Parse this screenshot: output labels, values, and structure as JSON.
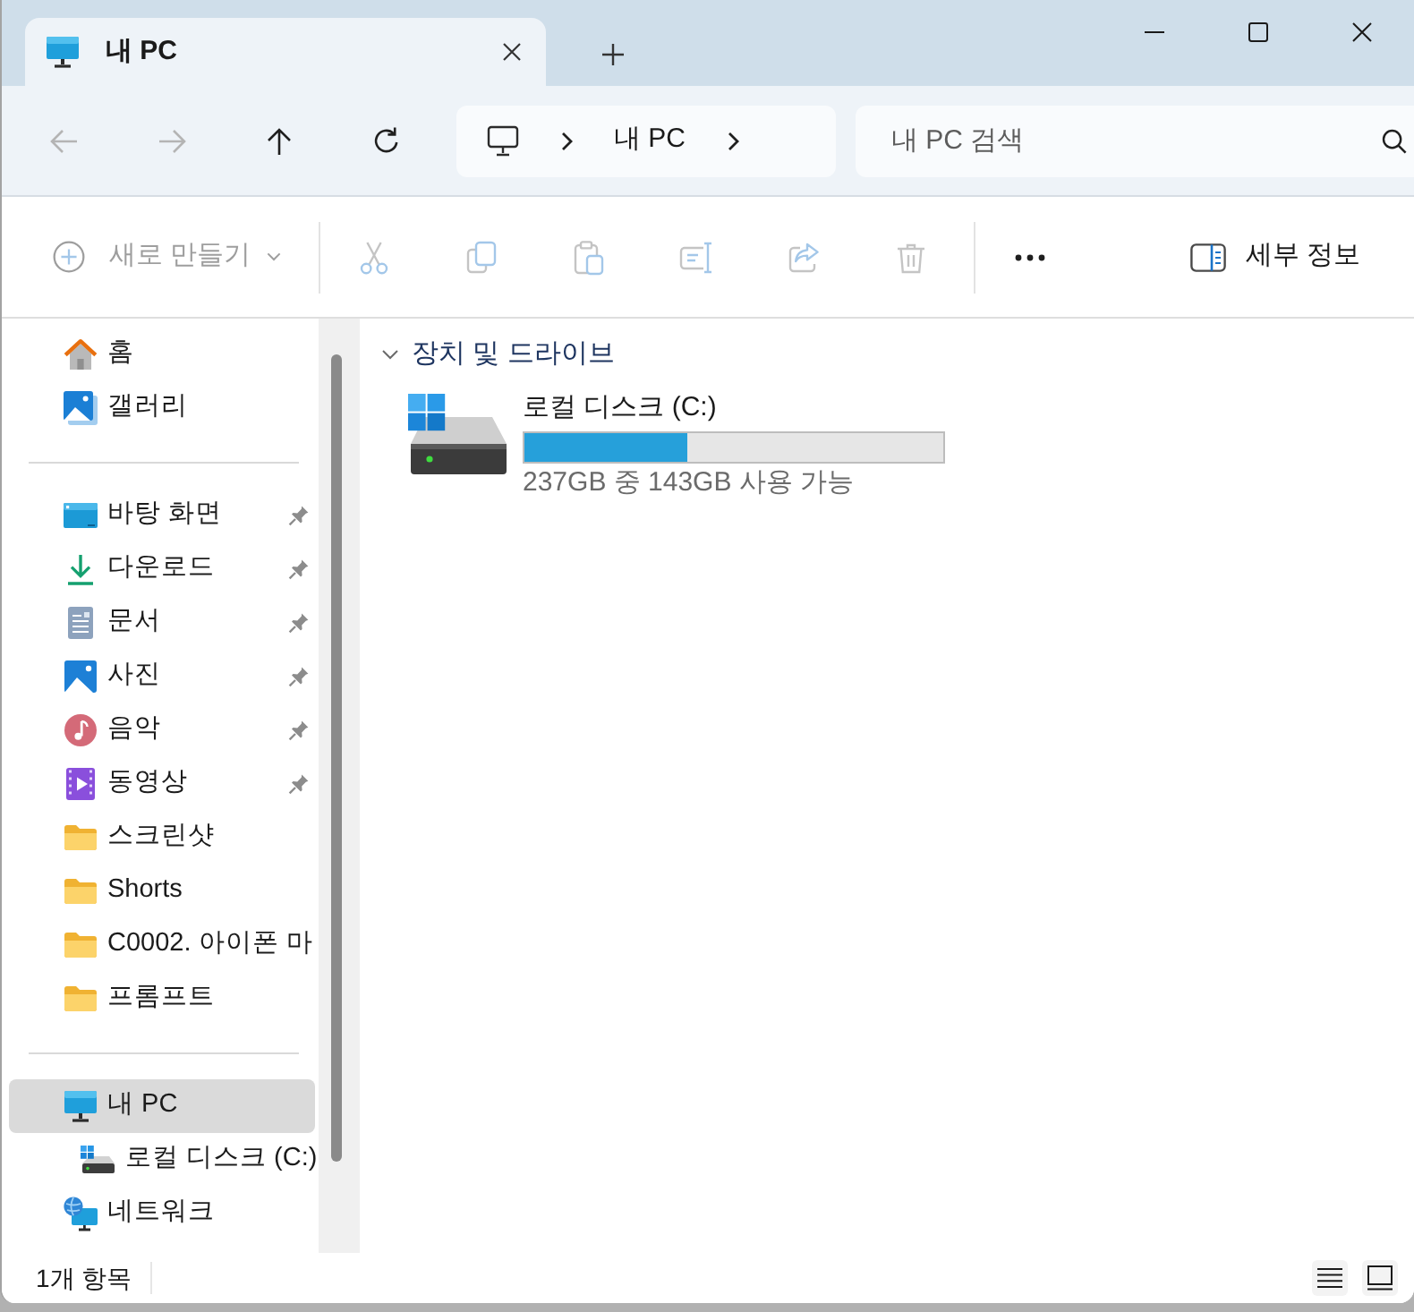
{
  "tabs": [
    {
      "label": "내 PC",
      "selected": true
    }
  ],
  "navigation": [
    {
      "kind": "back",
      "disabled": true
    },
    {
      "kind": "forward",
      "disabled": true
    },
    {
      "kind": "up",
      "disabled": false
    },
    {
      "kind": "refresh",
      "disabled": false
    }
  ],
  "address_bar": {
    "segments": [
      "내 PC"
    ]
  },
  "search": {
    "placeholder": "내 PC 검색"
  },
  "toolbar": {
    "items": [
      {
        "kind": "new",
        "label": "새로 만들기",
        "disabled": true
      },
      {
        "kind": "cut",
        "disabled": true
      },
      {
        "kind": "copy",
        "disabled": true
      },
      {
        "kind": "paste",
        "disabled": true
      },
      {
        "kind": "rename",
        "disabled": true
      },
      {
        "kind": "share",
        "disabled": true
      },
      {
        "kind": "delete",
        "disabled": true
      },
      {
        "kind": "more",
        "disabled": false
      }
    ],
    "details": {
      "label": "세부 정보"
    }
  },
  "sidebar": {
    "groups": [
      {
        "items": [
          {
            "kind": "home",
            "label": "홈",
            "pinned": false,
            "selected": false
          },
          {
            "kind": "gallery",
            "label": "갤러리",
            "pinned": false,
            "selected": false
          }
        ]
      },
      {
        "items": [
          {
            "kind": "desktop",
            "label": "바탕 화면",
            "pinned": true,
            "selected": false
          },
          {
            "kind": "downloads",
            "label": "다운로드",
            "pinned": true,
            "selected": false
          },
          {
            "kind": "documents",
            "label": "문서",
            "pinned": true,
            "selected": false
          },
          {
            "kind": "pictures",
            "label": "사진",
            "pinned": true,
            "selected": false
          },
          {
            "kind": "music",
            "label": "음악",
            "pinned": true,
            "selected": false
          },
          {
            "kind": "videos",
            "label": "동영상",
            "pinned": true,
            "selected": false
          },
          {
            "kind": "folder",
            "label": "스크린샷",
            "pinned": false,
            "selected": false
          },
          {
            "kind": "folder",
            "label": "Shorts",
            "pinned": false,
            "selected": false
          },
          {
            "kind": "folder",
            "label": "C0002. 아이폰 마",
            "pinned": false,
            "selected": false
          },
          {
            "kind": "folder",
            "label": "프롬프트",
            "pinned": false,
            "selected": false
          }
        ]
      },
      {
        "items": [
          {
            "kind": "pc",
            "label": "내 PC",
            "pinned": false,
            "selected": true,
            "children": [
              {
                "kind": "drive",
                "label": "로컬 디스크 (C:)",
                "pinned": false,
                "selected": false
              }
            ]
          },
          {
            "kind": "network",
            "label": "네트워크",
            "pinned": false,
            "selected": false
          }
        ]
      }
    ]
  },
  "content": {
    "groups": [
      {
        "title": "장치 및 드라이브",
        "expanded": true,
        "items": [
          {
            "name": "로컬 디스크 (C:)",
            "level": 0.39,
            "caption": "237GB 중 143GB 사용 가능"
          }
        ]
      }
    ]
  },
  "status_bar": {
    "item_count": "1개 항목"
  }
}
